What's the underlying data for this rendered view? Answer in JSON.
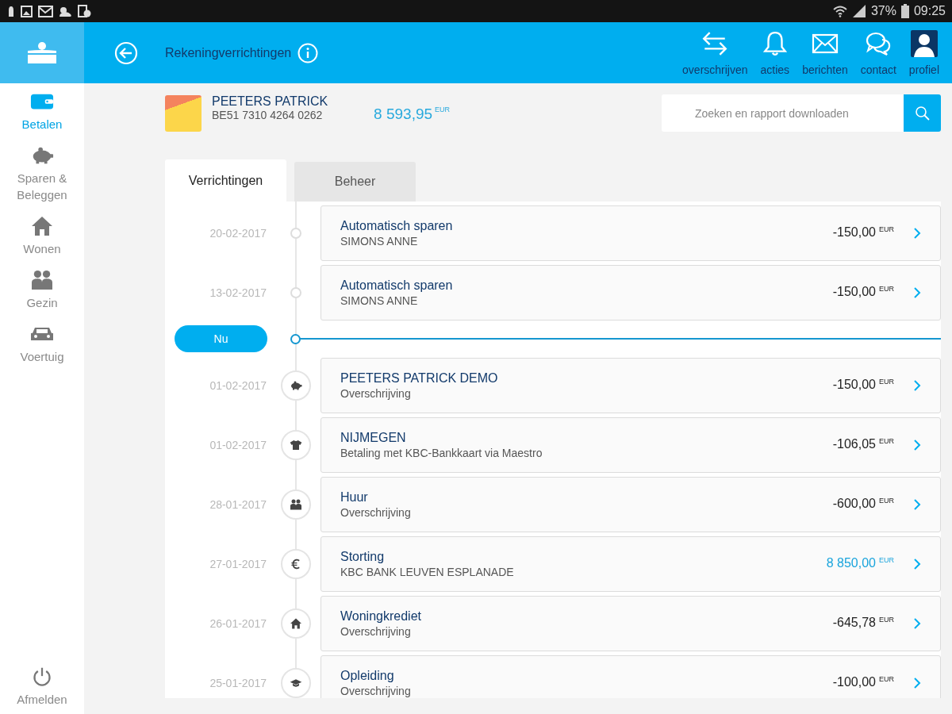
{
  "status_bar": {
    "battery": "37%",
    "time": "09:25"
  },
  "sidebar": {
    "items": [
      {
        "label": "Betalen",
        "kind": "wallet",
        "selected": true
      },
      {
        "label": "Sparen & Beleggen",
        "kind": "piggy",
        "selected": false
      },
      {
        "label": "Wonen",
        "kind": "house",
        "selected": false
      },
      {
        "label": "Gezin",
        "kind": "family",
        "selected": false
      },
      {
        "label": "Voertuig",
        "kind": "car",
        "selected": false
      }
    ],
    "logout": "Afmelden"
  },
  "header": {
    "title": "Rekeningverrichtingen",
    "actions": [
      {
        "label": "overschrijven",
        "kind": "transfer"
      },
      {
        "label": "acties",
        "kind": "bell"
      },
      {
        "label": "berichten",
        "kind": "mail"
      },
      {
        "label": "contact",
        "kind": "chat"
      },
      {
        "label": "profiel",
        "kind": "profile"
      }
    ]
  },
  "account": {
    "name": "PEETERS PATRICK",
    "iban": "BE51 7310 4264 0262",
    "balance": "8 593,95",
    "currency": "EUR"
  },
  "search": {
    "placeholder": "Zoeken en rapport downloaden"
  },
  "tabs": [
    {
      "label": "Verrichtingen",
      "selected": true
    },
    {
      "label": "Beheer",
      "selected": false
    }
  ],
  "now_label": "Nu",
  "planned": [
    {
      "date": "20-02-2017",
      "title": "Automatisch sparen",
      "subtitle": "SIMONS ANNE",
      "amount": "-150,00",
      "currency": "EUR",
      "incoming": false
    },
    {
      "date": "13-02-2017",
      "title": "Automatisch sparen",
      "subtitle": "SIMONS ANNE",
      "amount": "-150,00",
      "currency": "EUR",
      "incoming": false
    }
  ],
  "transactions": [
    {
      "date": "01-02-2017",
      "kind": "piggy",
      "title": "PEETERS PATRICK DEMO",
      "subtitle": "Overschrijving",
      "amount": "-150,00",
      "currency": "EUR",
      "incoming": false
    },
    {
      "date": "01-02-2017",
      "kind": "shirt",
      "title": "NIJMEGEN",
      "subtitle": "Betaling met KBC-Bankkaart via Maestro",
      "amount": "-106,05",
      "currency": "EUR",
      "incoming": false
    },
    {
      "date": "28-01-2017",
      "kind": "family",
      "title": "Huur",
      "subtitle": "Overschrijving",
      "amount": "-600,00",
      "currency": "EUR",
      "incoming": false
    },
    {
      "date": "27-01-2017",
      "kind": "euro",
      "title": "Storting",
      "subtitle": "KBC BANK LEUVEN ESPLANADE",
      "amount": "8 850,00",
      "currency": "EUR",
      "incoming": true
    },
    {
      "date": "26-01-2017",
      "kind": "house",
      "title": "Woningkrediet",
      "subtitle": "Overschrijving",
      "amount": "-645,78",
      "currency": "EUR",
      "incoming": false
    },
    {
      "date": "25-01-2017",
      "kind": "cap",
      "title": "Opleiding",
      "subtitle": "Overschrijving",
      "amount": "-100,00",
      "currency": "EUR",
      "incoming": false
    }
  ]
}
